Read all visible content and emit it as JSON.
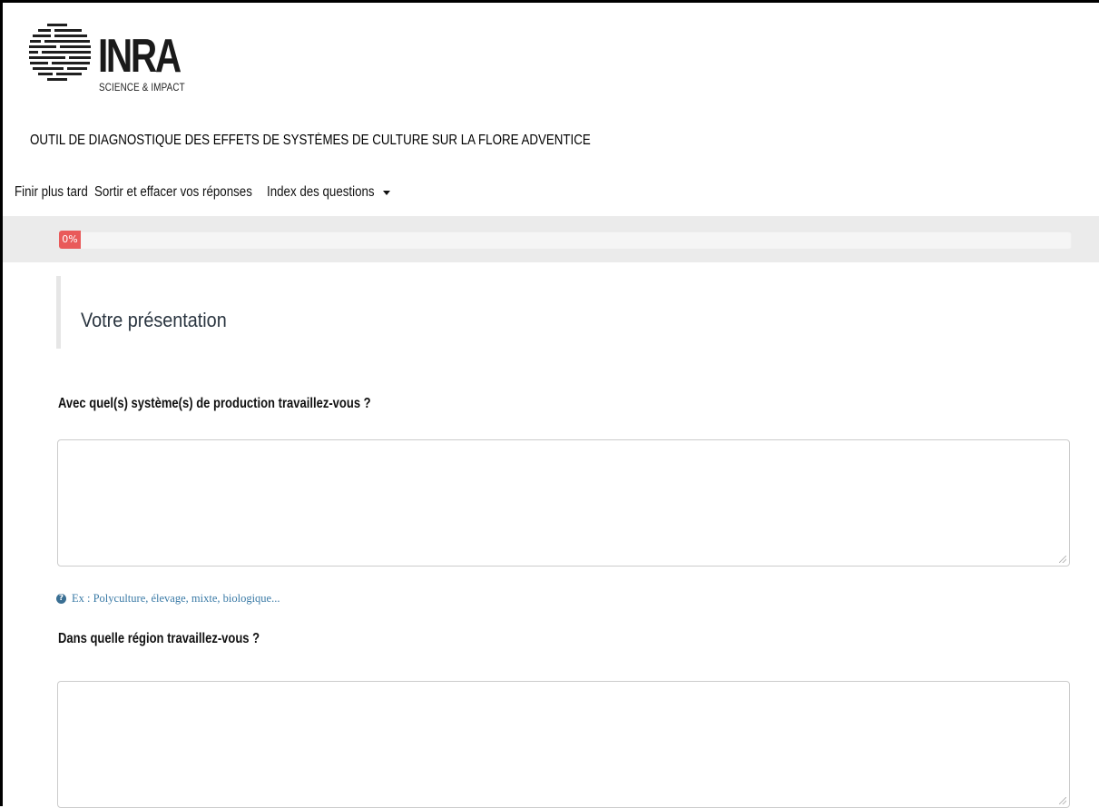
{
  "logo": {
    "wordmark": "INRA",
    "tagline": "SCIENCE & IMPACT"
  },
  "app_title": "OUTIL DE DIAGNOSTIQUE DES EFFETS DE SYSTÈMES DE CULTURE SUR LA FLORE ADVENTICE",
  "nav": {
    "finish_later": "Finir plus tard",
    "exit_clear": "Sortir et effacer vos réponses",
    "question_index": "Index des questions"
  },
  "progress": {
    "label": "0%",
    "value": 0,
    "color": "#e95a5a"
  },
  "group": {
    "title": "Votre présentation"
  },
  "questions": [
    {
      "label": "Avec quel(s) système(s) de production travaillez-vous ?",
      "value": "",
      "help": "Ex : Polyculture, élevage, mixte, biologique..."
    },
    {
      "label": "Dans quelle région travaillez-vous ?",
      "value": ""
    }
  ],
  "colors": {
    "help_text": "#3a7aa6",
    "band": "#ebebeb"
  }
}
